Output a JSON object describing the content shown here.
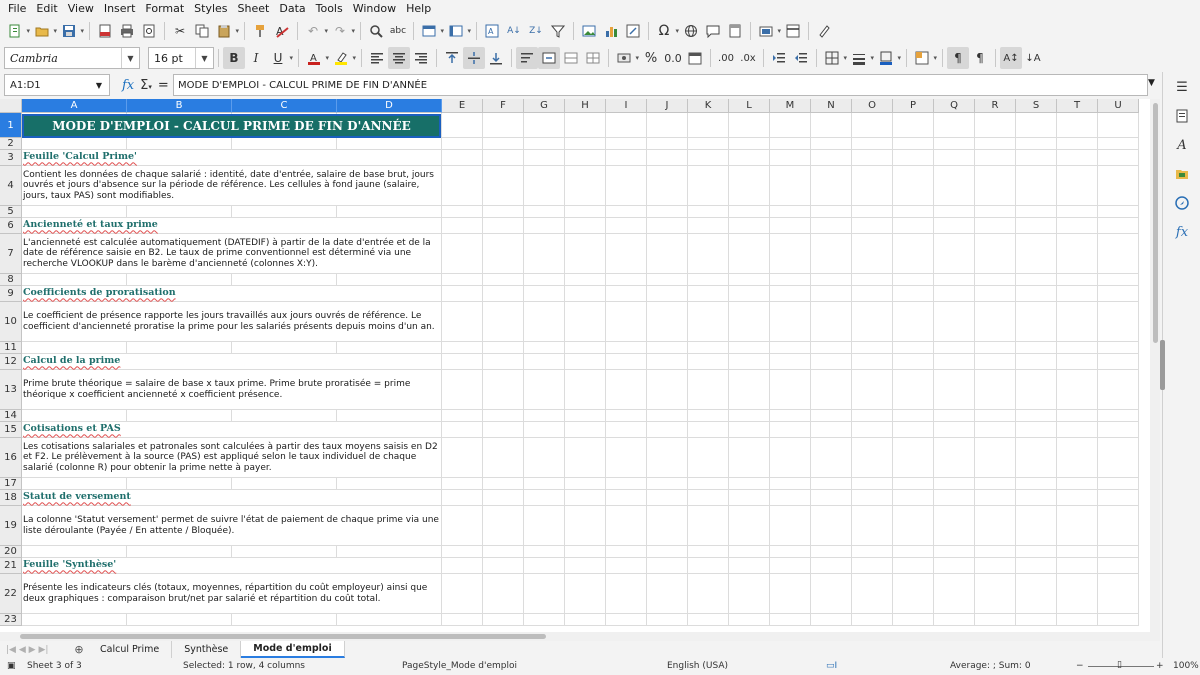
{
  "menu": [
    "File",
    "Edit",
    "View",
    "Insert",
    "Format",
    "Styles",
    "Sheet",
    "Data",
    "Tools",
    "Window",
    "Help"
  ],
  "toolbar": {
    "font_name": "Cambria",
    "font_size": "16 pt",
    "icons1": [
      "new-icon",
      "open-icon",
      "save-icon",
      "export-pdf-icon",
      "print-icon",
      "print-preview-icon",
      "cut-icon",
      "copy-icon",
      "paste-icon",
      "clone-format-icon",
      "clear-format-icon",
      "undo-icon",
      "redo-icon",
      "find-replace-icon",
      "spelling-icon",
      "row-icon",
      "column-icon",
      "sort-icon",
      "sort-ascending-icon",
      "sort-descending-icon",
      "autofilter-icon",
      "image-icon",
      "chart-icon",
      "pivot-table-icon",
      "special-character-icon",
      "hyperlink-icon",
      "comment-icon",
      "header-footer-icon",
      "define-print-area-icon",
      "freeze-icon",
      "split-window-icon",
      "show-draw-functions-icon"
    ],
    "icons2": [
      "bold-icon",
      "italic-icon",
      "underline-icon",
      "font-color-icon",
      "highlight-icon",
      "align-left-icon",
      "align-center-icon",
      "align-right-icon",
      "align-top-icon",
      "align-middle-icon",
      "align-bottom-icon",
      "wrap-text-icon",
      "merge-center-icon",
      "merge-cells-icon",
      "unmerge-cells-icon",
      "currency-icon",
      "percent-icon",
      "number-icon",
      "date-icon",
      "add-decimal-icon",
      "delete-decimal-icon",
      "increase-indent-icon",
      "decrease-indent-icon",
      "borders-icon",
      "border-style-icon",
      "border-color-icon",
      "conditional-icon",
      "left-to-right-icon",
      "right-to-left-icon",
      "text-orientation-icon",
      "vertical-text-icon"
    ]
  },
  "formula_bar": {
    "name_box": "A1:D1",
    "content": "MODE D'EMPLOI - CALCUL PRIME DE FIN D'ANNÉE"
  },
  "columns": [
    "A",
    "B",
    "C",
    "D",
    "E",
    "F",
    "G",
    "H",
    "I",
    "J",
    "K",
    "L",
    "M",
    "N",
    "O",
    "P",
    "Q",
    "R",
    "S",
    "T",
    "U"
  ],
  "rows": [
    "1",
    "2",
    "3",
    "4",
    "5",
    "6",
    "7",
    "8",
    "9",
    "10",
    "11",
    "12",
    "13",
    "14",
    "15",
    "16",
    "17",
    "18",
    "19",
    "20",
    "21",
    "22",
    "23"
  ],
  "title_cell": "MODE D'EMPLOI - CALCUL PRIME DE FIN D'ANNÉE",
  "sections": [
    {
      "heading": "Feuille 'Calcul Prime'",
      "body": "Contient les données de chaque salarié : identité, date d'entrée, salaire de base brut, jours ouvrés et jours d'absence sur la période de référence. Les cellules à fond jaune (salaire, jours, taux PAS) sont modifiables."
    },
    {
      "heading": "Ancienneté et taux prime",
      "body": "L'ancienneté est calculée automatiquement (DATEDIF) à partir de la date d'entrée et de la date de référence saisie en B2. Le taux de prime conventionnel est déterminé via une recherche VLOOKUP dans le barème d'ancienneté (colonnes X:Y)."
    },
    {
      "heading": "Coefficients de proratisation",
      "body": "Le coefficient de présence rapporte les jours travaillés aux jours ouvrés de référence. Le coefficient d'ancienneté proratise la prime pour les salariés présents depuis moins d'un an."
    },
    {
      "heading": "Calcul de la prime",
      "body": "Prime brute théorique = salaire de base x taux prime. Prime brute proratisée = prime théorique x coefficient ancienneté x coefficient présence."
    },
    {
      "heading": "Cotisations et PAS",
      "body": "Les cotisations salariales et patronales sont calculées à partir des taux moyens saisis en D2 et F2. Le prélèvement à la source (PAS) est appliqué selon le taux individuel de chaque salarié (colonne R) pour obtenir la prime nette à payer."
    },
    {
      "heading": "Statut de versement",
      "body": "La colonne 'Statut versement' permet de suivre l'état de paiement de chaque prime via une liste déroulante (Payée / En attente / Bloquée)."
    },
    {
      "heading": "Feuille 'Synthèse'",
      "body": "Présente les indicateurs clés (totaux, moyennes, répartition du coût employeur) ainsi que deux graphiques : comparaison brut/net par salarié et répartition du coût total."
    }
  ],
  "tabs": [
    "Calcul Prime",
    "Synthèse",
    "Mode d'emploi"
  ],
  "active_tab": "Mode d'emploi",
  "status": {
    "sheet": "Sheet 3 of 3",
    "selection": "Selected: 1 row, 4 columns",
    "page_style": "PageStyle_Mode d'emploi",
    "language": "English (USA)",
    "sum": "Average: ; Sum: 0",
    "zoom": "100%"
  },
  "colors": {
    "title_bg": "#176f68",
    "heading": "#1f6f6c",
    "selection": "#2a7de1"
  }
}
